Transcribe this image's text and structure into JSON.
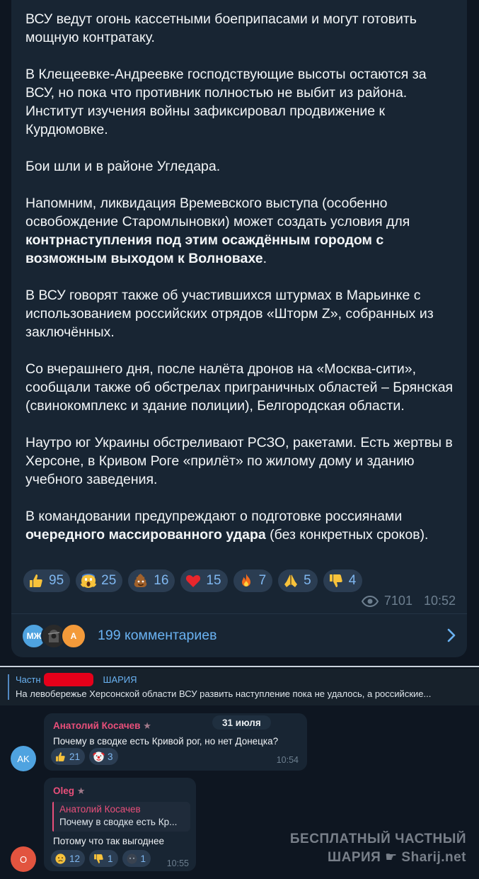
{
  "post": {
    "p1": "ВСУ ведут огонь кассетными боеприпасами и могут готовить мощную контратаку.",
    "p2": "В Клещеевке-Андреевке господствующие высоты остаются за ВСУ, но пока что противник полностью не выбит из района. Институт изучения войны зафиксировал продвижение к Курдюмовке.",
    "p3": "Бои шли и в районе Угледара.",
    "p4_a": "Напомним, ликвидация Времевского выступа (особенно освобождение Старомлыновки) может создать условия для ",
    "p4_b": "контрнаступления под этим осаждённым городом с возможным выходом к Волновахе",
    "p4_c": ".",
    "p5": "В ВСУ говорят также об участившихся штурмах в Марьинке с использованием российских отрядов «Шторм Z», собранных из заключённых.",
    "p6": "Со вчерашнего дня, после налёта дронов на «Москва-сити», сообщали также об обстрелах приграничных областей – Брянская (свинокомплекс и здание полиции), Белгородская области.",
    "p7": "Наутро юг Украины обстреливают РСЗО, ракетами. Есть жертвы в Херсоне, в Кривом Роге «прилёт» по жилому дому и зданию учебного заведения.",
    "p8_a": "В командовании предупреждают о подготовке россиянами ",
    "p8_b": "очередного массированного удара",
    "p8_c": " (без конкретных сроков).",
    "reactions": [
      {
        "icon": "thumbs-up-icon",
        "count": "95"
      },
      {
        "icon": "screaming-face-icon",
        "count": "25"
      },
      {
        "icon": "poop-icon",
        "count": "16"
      },
      {
        "icon": "heart-icon",
        "count": "15"
      },
      {
        "icon": "fire-icon",
        "count": "7"
      },
      {
        "icon": "folded-hands-icon",
        "count": "5"
      },
      {
        "icon": "thumbs-down-icon",
        "count": "4"
      }
    ],
    "views": "7101",
    "time": "10:52",
    "comment_avatars": [
      "МЖ",
      "A"
    ],
    "comments_label": "199 комментариев"
  },
  "discussion": {
    "pinned_title": "Частн",
    "pinned_title_end": "ШАРИЯ",
    "pinned_text": "На левобережье Херсонской области ВСУ развить наступление пока не удалось, а российские..."
  },
  "messages": [
    {
      "avatar": "AK",
      "name": "Анатолий Косачев",
      "date": "31 июля",
      "text": "Почему в сводке есть Кривой рог, но нет Донецка?",
      "reactions": [
        {
          "icon": "thumbs-up-icon",
          "count": "21"
        },
        {
          "icon": "clown-face-icon",
          "count": "3"
        }
      ],
      "time": "10:54"
    },
    {
      "avatar": "O",
      "name": "Oleg",
      "reply_name": "Анатолий Косачев",
      "reply_text": "Почему в сводке есть Кр...",
      "text": "Потому что так выгоднее",
      "reactions": [
        {
          "icon": "sad-face-icon",
          "count": "12"
        },
        {
          "icon": "thumbs-down-icon",
          "count": "1"
        },
        {
          "icon": "dark-emoji-icon",
          "count": "1"
        }
      ],
      "time": "10:55"
    }
  ],
  "watermark": {
    "line1": "БЕСПЛАТНЫЙ ЧАСТНЫЙ",
    "line2a": "ШАРИЯ",
    "line2b": "Sharij.net"
  },
  "colors": {
    "accent": "#6ab2f2",
    "bubble": "#182533",
    "background": "#0e1621",
    "name": "#e94f7a"
  }
}
